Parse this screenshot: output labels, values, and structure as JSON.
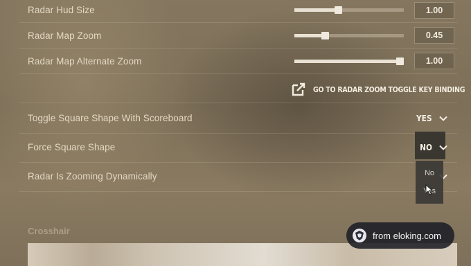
{
  "settings": {
    "rows": [
      {
        "label": "Radar Hud Size",
        "value": "1.00",
        "fraction": 0.4
      },
      {
        "label": "Radar Map Zoom",
        "value": "0.45",
        "fraction": 0.28
      },
      {
        "label": "Radar Map Alternate Zoom",
        "value": "1.00",
        "fraction": 0.96
      }
    ],
    "keybind_link": "GO TO RADAR ZOOM TOGGLE KEY BINDING",
    "toggles": [
      {
        "label": "Toggle Square Shape With Scoreboard",
        "value": "YES"
      },
      {
        "label": "Force Square Shape",
        "value": "NO"
      },
      {
        "label": "Radar Is Zooming Dynamically",
        "value": ""
      }
    ],
    "dropdown_options": [
      "No",
      "Yes"
    ],
    "section_title": "Crosshair"
  },
  "watermark": {
    "text": "from eloking.com"
  },
  "icons": {
    "external_link": "external-link-icon",
    "chevron": "chevron-down-icon",
    "cursor": "mouse-cursor-icon",
    "logo": "eloking-logo-icon"
  },
  "colors": {
    "text": "#e3d8c3",
    "value_text": "#f1eadc",
    "slider_track": "#d2c8b4",
    "watermark_bg": "#1c1e26"
  }
}
